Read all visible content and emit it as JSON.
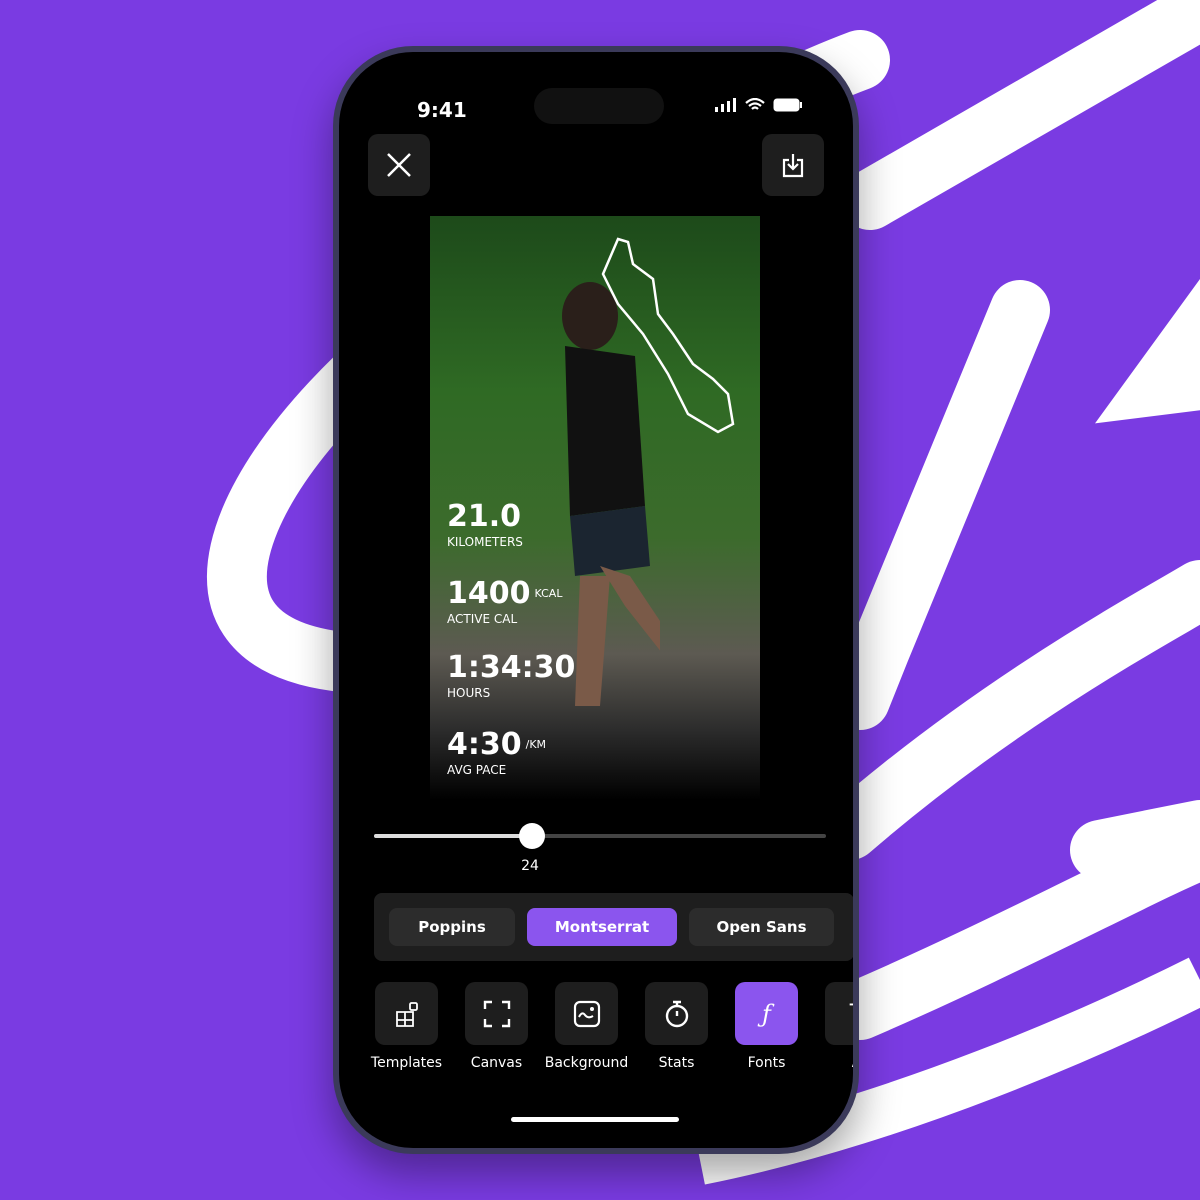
{
  "colors": {
    "background": "#7a3be2",
    "accent": "#8b55ee",
    "screen": "#000000"
  },
  "status_bar": {
    "time": "9:41"
  },
  "top_bar": {
    "close_icon": "close-icon",
    "download_icon": "download-icon"
  },
  "stats": [
    {
      "value": "21.0",
      "unit": "",
      "label": "KILOMETERS"
    },
    {
      "value": "1400",
      "unit": "KCAL",
      "label": "ACTIVE CAL"
    },
    {
      "value": "1:34:30",
      "unit": "",
      "label": "HOURS"
    },
    {
      "value": "4:30",
      "unit": "/KM",
      "label": "AVG PACE"
    }
  ],
  "slider": {
    "value": "24",
    "percent": 35
  },
  "fonts": [
    {
      "label": "Poppins",
      "selected": false
    },
    {
      "label": "Montserrat",
      "selected": true
    },
    {
      "label": "Open Sans",
      "selected": false
    }
  ],
  "tools": [
    {
      "label": "Templates",
      "icon": "templates-icon"
    },
    {
      "label": "Canvas",
      "icon": "canvas-icon"
    },
    {
      "label": "Background",
      "icon": "image-icon"
    },
    {
      "label": "Stats",
      "icon": "stopwatch-icon"
    },
    {
      "label": "Fonts",
      "icon": "font-icon",
      "selected": true
    },
    {
      "label": "A",
      "icon": "text-icon"
    }
  ]
}
